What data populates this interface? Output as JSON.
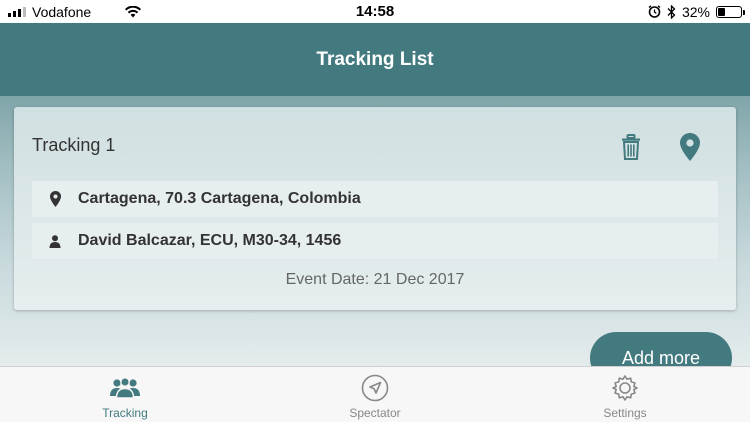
{
  "status_bar": {
    "carrier": "Vodafone",
    "time": "14:58",
    "battery_percent": "32%",
    "battery_level": 0.32,
    "icons": [
      "signal-icon",
      "wifi-icon",
      "alarm-icon",
      "bluetooth-icon",
      "battery-icon"
    ]
  },
  "header": {
    "title": "Tracking List"
  },
  "tracking_card": {
    "title": "Tracking 1",
    "location": "Cartagena, 70.3 Cartagena, Colombia",
    "athlete": "David Balcazar, ECU, M30-34, 1456",
    "event_date": "Event Date: 21 Dec 2017"
  },
  "actions": {
    "add_more": "Add more"
  },
  "tabs": [
    {
      "label": "Tracking",
      "icon": "group-icon",
      "active": true
    },
    {
      "label": "Spectator",
      "icon": "navigation-icon",
      "active": false
    },
    {
      "label": "Settings",
      "icon": "gear-icon",
      "active": false
    }
  ],
  "colors": {
    "primary": "#437a7f",
    "tab_inactive": "#888888"
  }
}
